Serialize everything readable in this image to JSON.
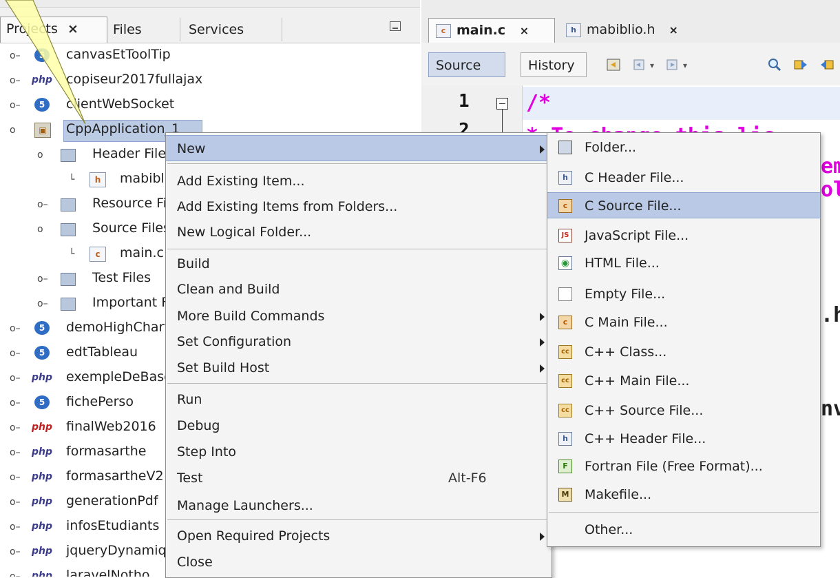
{
  "projects_panel": {
    "tabs": {
      "projects": "Projects",
      "projects_close": "×",
      "files": "Files",
      "services": "Services"
    },
    "tree": [
      {
        "label": "canvasEtToolTip",
        "icon": "html5-icon"
      },
      {
        "label": "copiseur2017fullajax",
        "icon": "php-icon"
      },
      {
        "label": "clientWebSocket",
        "icon": "html5-icon"
      },
      {
        "label": "CppApplication_1",
        "icon": "c-project-icon"
      },
      {
        "label": "Header Files",
        "icon": "folder-icon"
      },
      {
        "label": "mabiblio.h",
        "icon": "c-header-icon"
      },
      {
        "label": "Resource Files",
        "icon": "folder-icon"
      },
      {
        "label": "Source Files",
        "icon": "folder-icon"
      },
      {
        "label": "main.c",
        "icon": "c-source-icon"
      },
      {
        "label": "Test Files",
        "icon": "test-folder-icon"
      },
      {
        "label": "Important Files",
        "icon": "important-folder-icon"
      },
      {
        "label": "demoHighCharts",
        "icon": "html5-icon"
      },
      {
        "label": "edtTableau",
        "icon": "html5-icon"
      },
      {
        "label": "exempleDeBase",
        "icon": "php-icon"
      },
      {
        "label": "fichePerso",
        "icon": "html5-icon"
      },
      {
        "label": "finalWeb2016",
        "icon": "php-error-icon"
      },
      {
        "label": "formasarthe",
        "icon": "php-icon"
      },
      {
        "label": "formasartheV2",
        "icon": "php-icon"
      },
      {
        "label": "generationPdf",
        "icon": "php-icon"
      },
      {
        "label": "infosEtudiants",
        "icon": "php-icon"
      },
      {
        "label": "jqueryDynamique",
        "icon": "php-icon"
      },
      {
        "label": "laravelNotho",
        "icon": "php-icon"
      }
    ]
  },
  "editor": {
    "tabs": [
      {
        "label": "main.c",
        "close": "×",
        "active": true
      },
      {
        "label": "mabiblio.h",
        "close": "×",
        "active": false
      }
    ],
    "toolbar": {
      "source": "Source",
      "history": "History"
    },
    "line_numbers": [
      "1",
      "2"
    ],
    "code_lines": [
      "/*",
      " * To change this lic",
      "em",
      "ol",
      ".h",
      "nv"
    ]
  },
  "context_menu": {
    "items": [
      {
        "label": "New",
        "submenu": true
      },
      {
        "label": "Add Existing Item..."
      },
      {
        "label": "Add Existing Items from Folders..."
      },
      {
        "label": "New Logical Folder..."
      },
      {
        "label": "Build"
      },
      {
        "label": "Clean and Build"
      },
      {
        "label": "More Build Commands",
        "submenu": true
      },
      {
        "label": "Set Configuration",
        "submenu": true
      },
      {
        "label": "Set Build Host",
        "submenu": true
      },
      {
        "label": "Run"
      },
      {
        "label": "Debug"
      },
      {
        "label": "Step Into"
      },
      {
        "label": "Test",
        "accelerator": "Alt-F6"
      },
      {
        "label": "Manage Launchers..."
      },
      {
        "label": "Open Required Projects",
        "submenu": true
      },
      {
        "label": "Close"
      }
    ]
  },
  "new_submenu": {
    "items": [
      {
        "label": "Folder...",
        "icon": "folder-icon",
        "glyph": ""
      },
      {
        "label": "C Header File...",
        "icon": "c-header-file-icon",
        "glyph": "h"
      },
      {
        "label": "C Source File...",
        "icon": "c-source-file-icon",
        "glyph": "c",
        "selected": true
      },
      {
        "label": "JavaScript File...",
        "icon": "javascript-file-icon",
        "glyph": "JS"
      },
      {
        "label": "HTML File...",
        "icon": "html-file-icon",
        "glyph": "◉"
      },
      {
        "label": "Empty File...",
        "icon": "empty-file-icon",
        "glyph": ""
      },
      {
        "label": "C Main File...",
        "icon": "c-main-file-icon",
        "glyph": "c"
      },
      {
        "label": "C++ Class...",
        "icon": "cpp-class-icon",
        "glyph": "cc"
      },
      {
        "label": "C++ Main File...",
        "icon": "cpp-main-file-icon",
        "glyph": "cc"
      },
      {
        "label": "C++ Source File...",
        "icon": "cpp-source-file-icon",
        "glyph": "cc"
      },
      {
        "label": "C++ Header File...",
        "icon": "cpp-header-file-icon",
        "glyph": "h"
      },
      {
        "label": "Fortran File (Free Format)...",
        "icon": "fortran-file-icon",
        "glyph": "F"
      },
      {
        "label": "Makefile...",
        "icon": "makefile-icon",
        "glyph": "M"
      },
      {
        "label": "Other...",
        "icon": "",
        "glyph": ""
      }
    ]
  },
  "colors": {
    "selection": "#b9c9e6",
    "code_comment": "#e000e0",
    "callout": "#ffffa8"
  }
}
